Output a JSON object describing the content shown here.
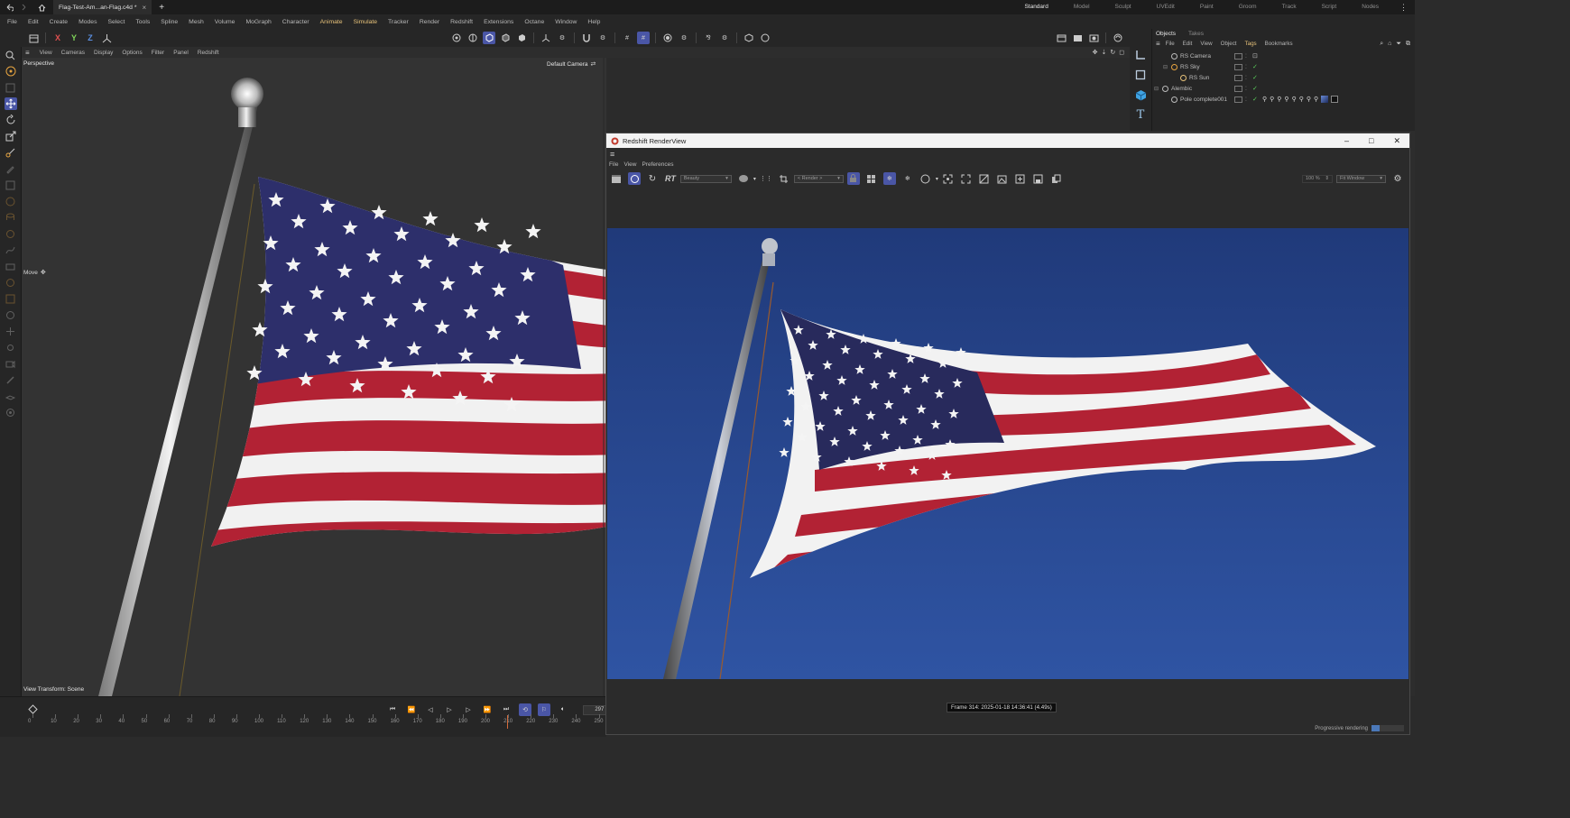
{
  "window": {
    "tab_title": "Flag-Test-Am...an-Flag.c4d *",
    "plus": "+"
  },
  "workspaces": [
    "Standard",
    "Model",
    "Sculpt",
    "UVEdit",
    "Paint",
    "Groom",
    "Track",
    "Script",
    "Nodes"
  ],
  "menu": [
    {
      "label": "File",
      "hl": false
    },
    {
      "label": "Edit",
      "hl": false
    },
    {
      "label": "Create",
      "hl": false
    },
    {
      "label": "Modes",
      "hl": false
    },
    {
      "label": "Select",
      "hl": false
    },
    {
      "label": "Tools",
      "hl": false
    },
    {
      "label": "Spline",
      "hl": false
    },
    {
      "label": "Mesh",
      "hl": false
    },
    {
      "label": "Volume",
      "hl": false
    },
    {
      "label": "MoGraph",
      "hl": false
    },
    {
      "label": "Character",
      "hl": false
    },
    {
      "label": "Animate",
      "hl": true
    },
    {
      "label": "Simulate",
      "hl": true
    },
    {
      "label": "Tracker",
      "hl": false
    },
    {
      "label": "Render",
      "hl": false
    },
    {
      "label": "Redshift",
      "hl": false
    },
    {
      "label": "Extensions",
      "hl": false
    },
    {
      "label": "Octane",
      "hl": false
    },
    {
      "label": "Window",
      "hl": false
    },
    {
      "label": "Help",
      "hl": false
    }
  ],
  "axis_buttons": {
    "x": "X",
    "y": "Y",
    "z": "Z"
  },
  "viewport": {
    "menu": [
      "View",
      "Cameras",
      "Display",
      "Options",
      "Filter",
      "Panel",
      "Redshift"
    ],
    "label": "Perspective",
    "camera": "Default Camera",
    "move_label": "Move",
    "view_transform": "View Transform: Scene"
  },
  "object_manager": {
    "tabs": [
      "Objects",
      "Takes"
    ],
    "menu": [
      "File",
      "Edit",
      "View",
      "Object",
      "Tags",
      "Bookmarks"
    ],
    "objects": [
      {
        "name": "RS Camera"
      },
      {
        "name": "RS Sky"
      },
      {
        "name": "RS Sun"
      },
      {
        "name": "Alembic"
      },
      {
        "name": "Pole complete001"
      }
    ]
  },
  "timeline": {
    "current_frame": "297 F",
    "ticks": [
      "0",
      "10",
      "20",
      "30",
      "40",
      "50",
      "60",
      "70",
      "80",
      "90",
      "100",
      "110",
      "120",
      "130",
      "140",
      "150",
      "160",
      "170",
      "180",
      "190",
      "200",
      "210",
      "220",
      "230",
      "240",
      "250"
    ]
  },
  "render_view": {
    "title": "Redshift RenderView",
    "menu": [
      "File",
      "View",
      "Preferences"
    ],
    "rt_label": "RT",
    "aov": "Beauty",
    "render_dropdown": "< Render >",
    "zoom": "100 %",
    "fit": "Fit Window",
    "frame_info": "Frame  314:  2025-01-18  14:36:41  (4.49s)",
    "status": "Progressive rendering",
    "progress_fraction": 0.25
  },
  "colors": {
    "accent": "#4a56a6",
    "check": "#5bd05b",
    "highlight": "#e7c27a",
    "sky": "#1f3a78",
    "flag_red": "#b22234",
    "flag_blue": "#2d2f6b"
  }
}
